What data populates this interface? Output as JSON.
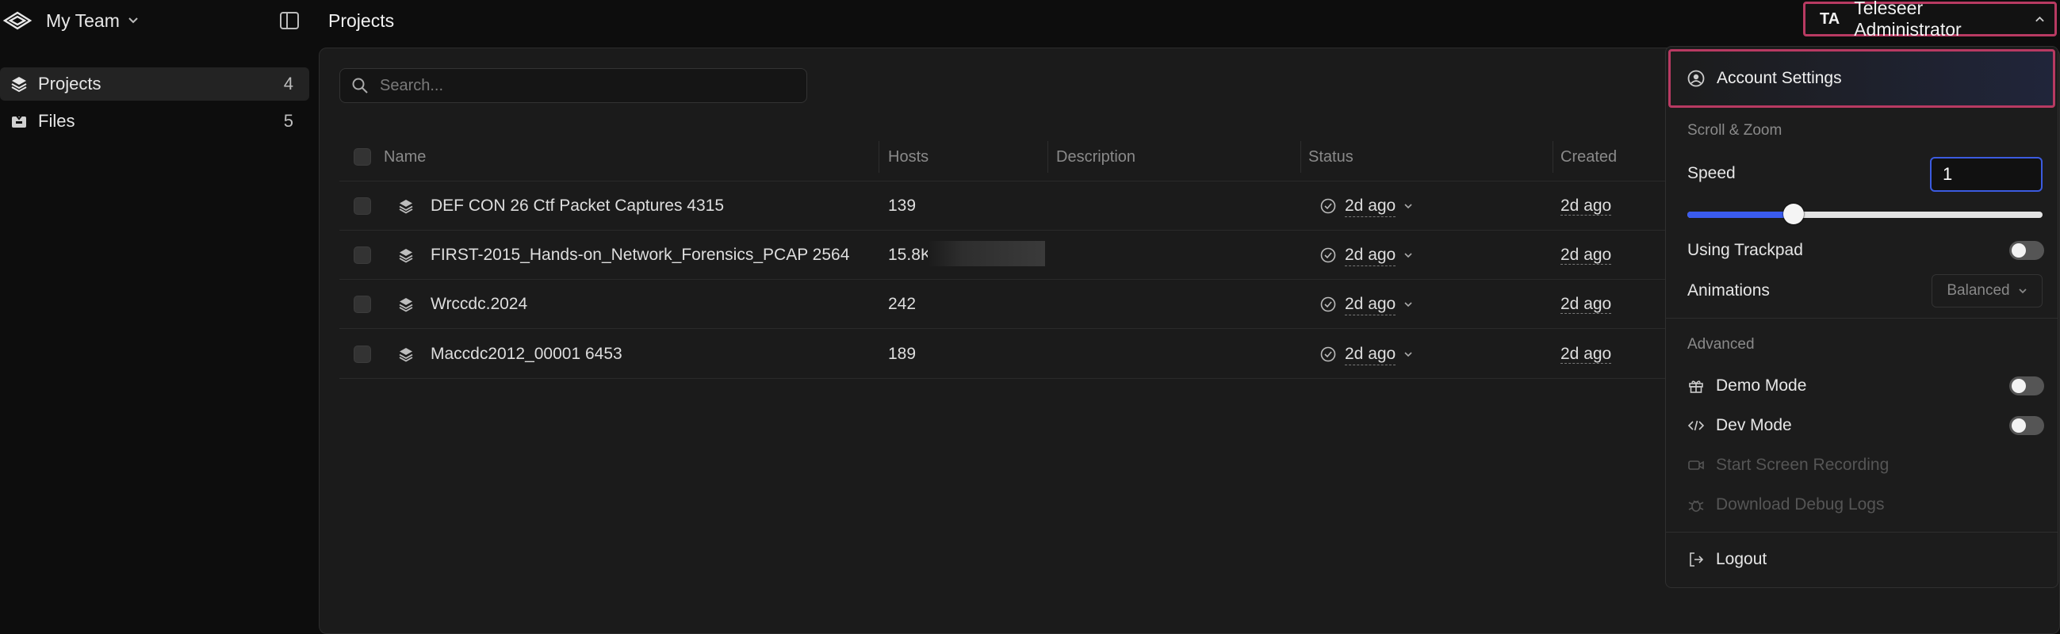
{
  "top_bar": {
    "team_name": "My Team",
    "page_title": "Projects",
    "user_initials": "TA",
    "user_name": "Teleseer Administrator"
  },
  "sidebar": {
    "items": [
      {
        "label": "Projects",
        "count": "4",
        "icon": "layers-icon",
        "active": true
      },
      {
        "label": "Files",
        "count": "5",
        "icon": "inbox-icon",
        "active": false
      }
    ]
  },
  "search": {
    "placeholder": "Search..."
  },
  "table": {
    "columns": [
      "Name",
      "Hosts",
      "Description",
      "Status",
      "Created"
    ],
    "rows": [
      {
        "name": "DEF CON 26 Ctf Packet Captures 4315",
        "hosts": "139",
        "description": "",
        "status": "2d ago",
        "created": "2d ago"
      },
      {
        "name": "FIRST-2015_Hands-on_Network_Forensics_PCAP 2564",
        "hosts": "15.8K",
        "description": "",
        "status": "2d ago",
        "created": "2d ago"
      },
      {
        "name": "Wrccdc.2024",
        "hosts": "242",
        "description": "",
        "status": "2d ago",
        "created": "2d ago"
      },
      {
        "name": "Maccdc2012_00001 6453",
        "hosts": "189",
        "description": "",
        "status": "2d ago",
        "created": "2d ago"
      }
    ]
  },
  "menu": {
    "account_settings": "Account Settings",
    "scroll_zoom_title": "Scroll & Zoom",
    "speed_label": "Speed",
    "speed_value": "1",
    "speed_slider_fraction": 0.3,
    "trackpad_label": "Using Trackpad",
    "animations_label": "Animations",
    "animations_value": "Balanced",
    "advanced_title": "Advanced",
    "demo_mode": "Demo Mode",
    "dev_mode": "Dev Mode",
    "start_recording": "Start Screen Recording",
    "download_logs": "Download Debug Logs",
    "logout": "Logout"
  },
  "colors": {
    "accent": "#3a5bef",
    "highlight_border": "#b83a62"
  }
}
